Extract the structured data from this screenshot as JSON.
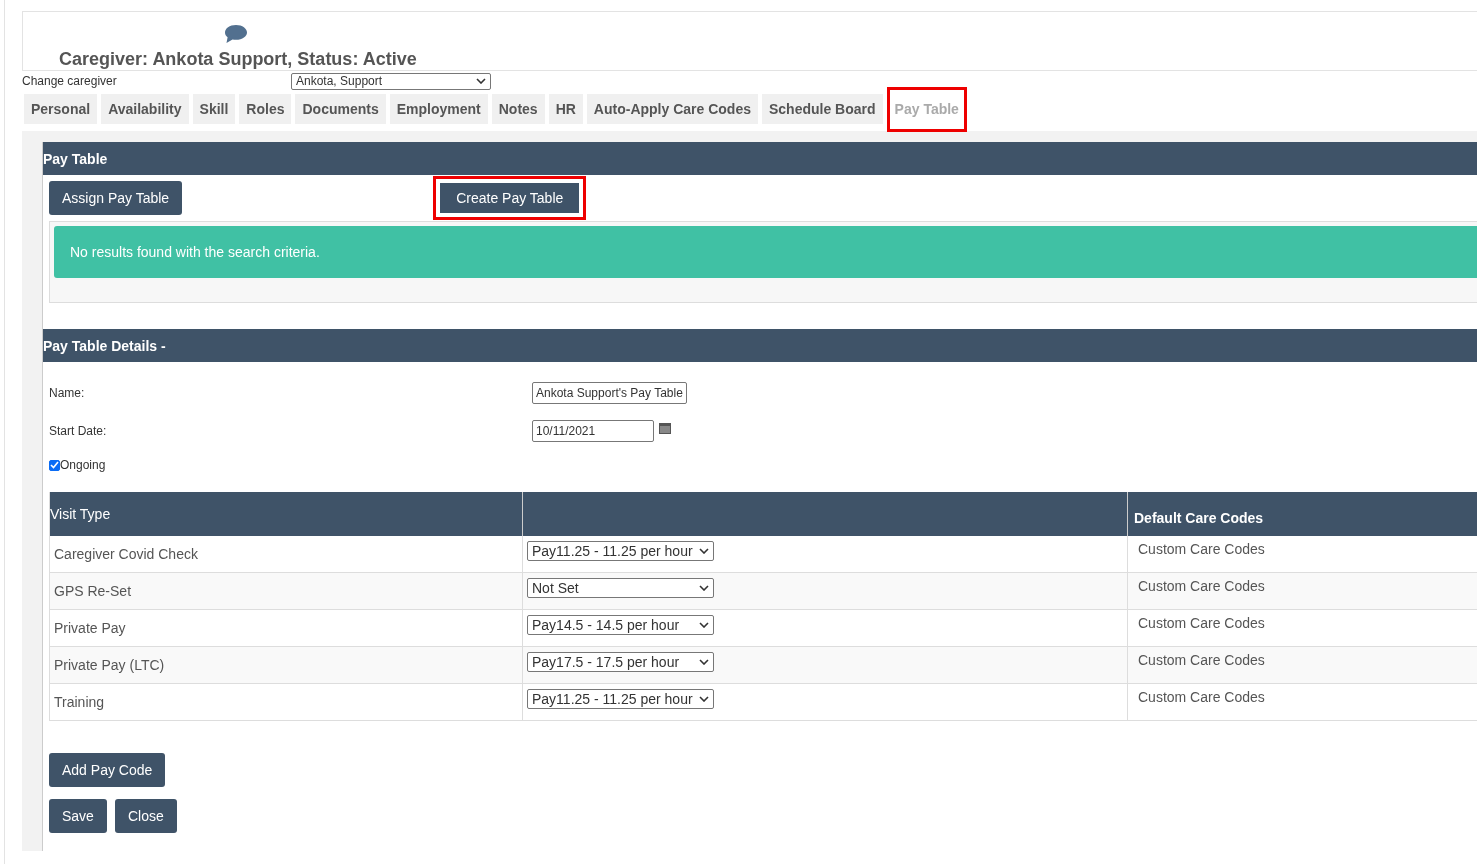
{
  "header": {
    "title": "Caregiver: Ankota Support, Status: Active"
  },
  "change_caregiver": {
    "label": "Change caregiver",
    "value": "Ankota, Support"
  },
  "tabs": [
    {
      "label": "Personal",
      "selected": false,
      "highlighted": false
    },
    {
      "label": "Availability",
      "selected": false,
      "highlighted": false
    },
    {
      "label": "Skill",
      "selected": false,
      "highlighted": false
    },
    {
      "label": "Roles",
      "selected": false,
      "highlighted": false
    },
    {
      "label": "Documents",
      "selected": false,
      "highlighted": false
    },
    {
      "label": "Employment",
      "selected": false,
      "highlighted": false
    },
    {
      "label": "Notes",
      "selected": false,
      "highlighted": false
    },
    {
      "label": "HR",
      "selected": false,
      "highlighted": false
    },
    {
      "label": "Auto-Apply Care Codes",
      "selected": false,
      "highlighted": false
    },
    {
      "label": "Schedule Board",
      "selected": false,
      "highlighted": false
    },
    {
      "label": "Pay Table",
      "selected": true,
      "highlighted": true
    }
  ],
  "pay_table": {
    "title": "Pay Table",
    "buttons": [
      {
        "label": "Assign Pay Table",
        "highlighted": false
      },
      {
        "label": "Create Pay Table",
        "highlighted": true
      }
    ],
    "message": "No results found with the search criteria."
  },
  "details": {
    "title": "Pay Table Details -",
    "name_label": "Name:",
    "name_value": "Ankota Support's Pay Table",
    "start_label": "Start Date:",
    "start_value": "10/11/2021",
    "ongoing": {
      "label": "Ongoing",
      "checked": true
    },
    "columns": [
      "Visit Type",
      "Default Care Codes"
    ],
    "rows": [
      {
        "visit_type": "Caregiver Covid Check",
        "pay_code": "Pay11.25 - 11.25 per hour",
        "care_codes": "Custom Care Codes"
      },
      {
        "visit_type": "GPS Re-Set",
        "pay_code": "Not Set",
        "care_codes": "Custom Care Codes"
      },
      {
        "visit_type": "Private Pay",
        "pay_code": "Pay14.5 - 14.5 per hour",
        "care_codes": "Custom Care Codes"
      },
      {
        "visit_type": "Private Pay (LTC)",
        "pay_code": "Pay17.5 - 17.5 per hour",
        "care_codes": "Custom Care Codes"
      },
      {
        "visit_type": "Training",
        "pay_code": "Pay11.25 - 11.25 per hour",
        "care_codes": "Custom Care Codes"
      }
    ],
    "add_button": "Add Pay Code",
    "actions": [
      "Save",
      "Close"
    ]
  }
}
